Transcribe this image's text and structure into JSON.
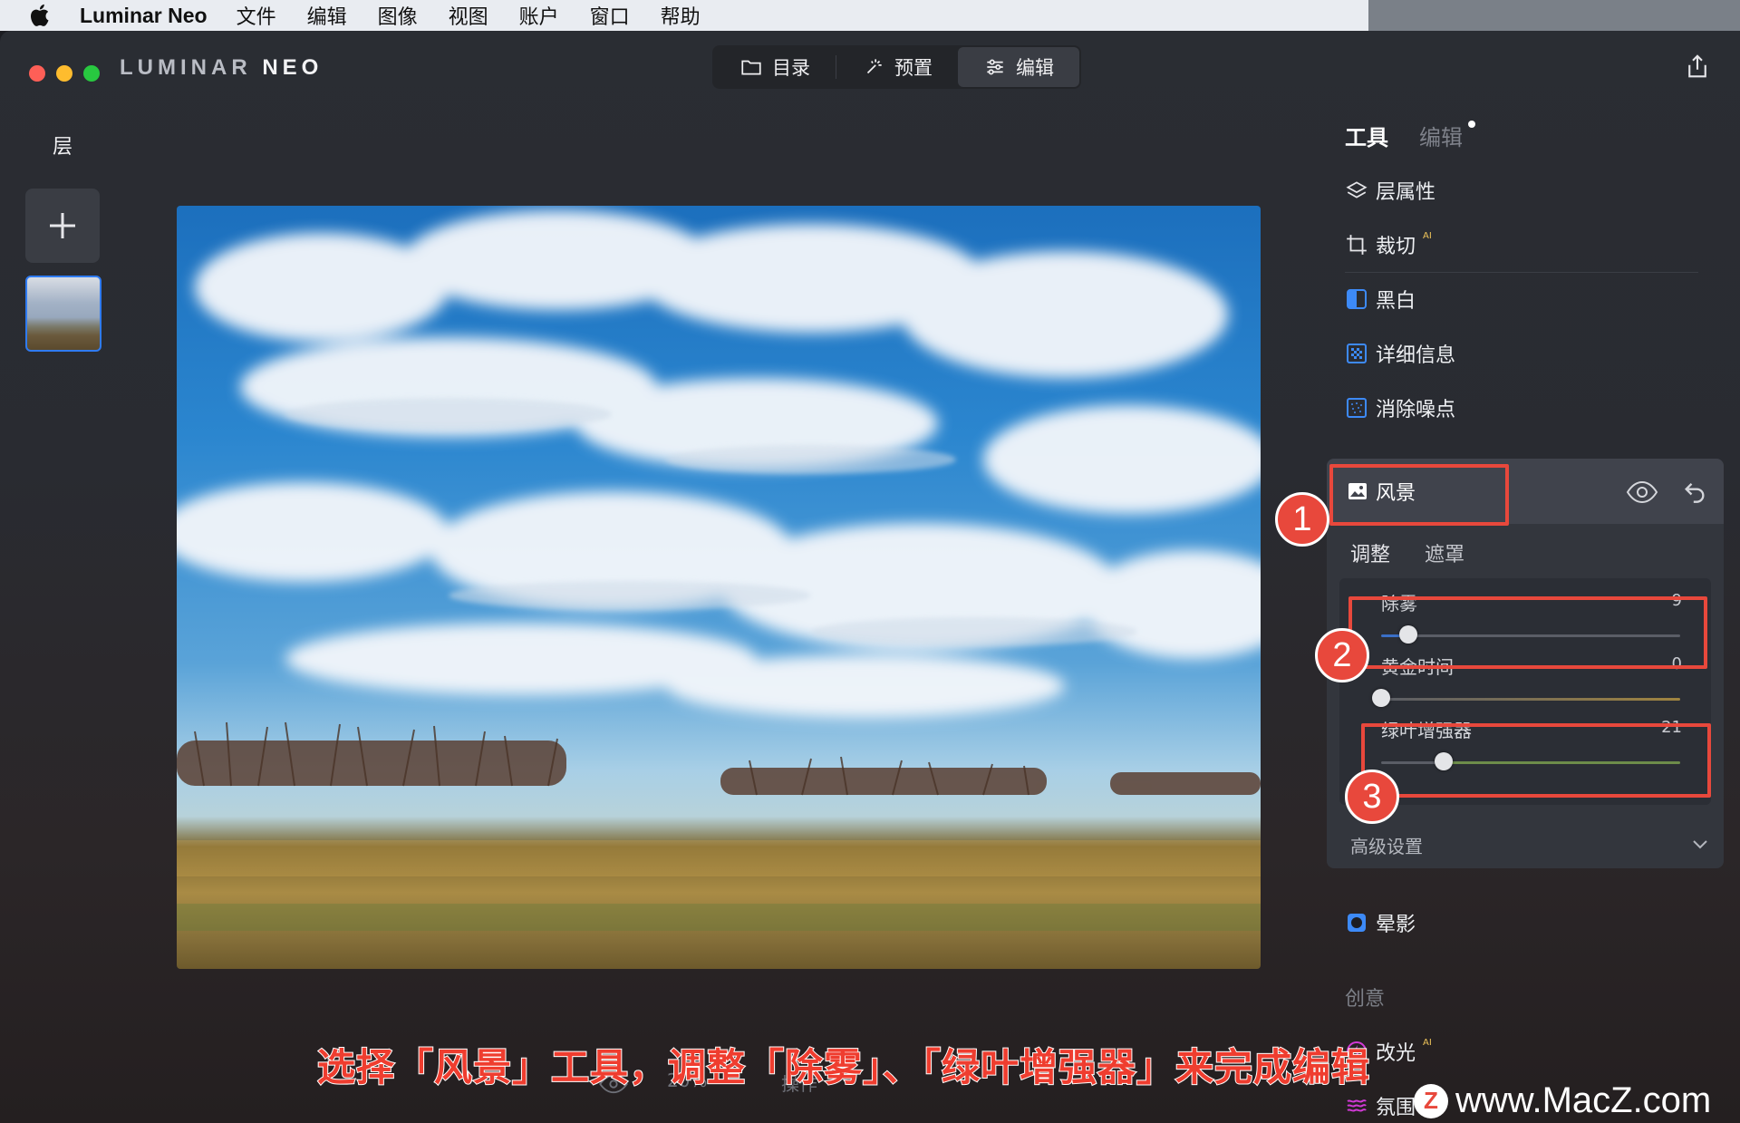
{
  "menubar": {
    "app_name": "Luminar Neo",
    "items": [
      "文件",
      "编辑",
      "图像",
      "视图",
      "账户",
      "窗口",
      "帮助"
    ]
  },
  "window": {
    "logo_left": "LUMINAR ",
    "logo_right": "NEO",
    "nav": [
      {
        "label": "目录",
        "icon": "folder-icon",
        "active": false
      },
      {
        "label": "预置",
        "icon": "magic-wand-icon",
        "active": false
      },
      {
        "label": "编辑",
        "icon": "sliders-icon",
        "active": true
      }
    ]
  },
  "layers": {
    "title": "层"
  },
  "right_panel": {
    "tabs": {
      "tools": "工具",
      "edits": "编辑"
    },
    "tools": [
      {
        "label": "层属性",
        "icon": "layers-icon"
      },
      {
        "label": "裁切",
        "icon": "crop-icon",
        "ai": "AI"
      },
      {
        "label": "黑白",
        "icon": "bw-icon"
      },
      {
        "label": "详细信息",
        "icon": "details-icon"
      },
      {
        "label": "消除噪点",
        "icon": "denoise-icon"
      }
    ],
    "landscape": {
      "title": "风景",
      "subtabs": [
        "调整",
        "遮罩"
      ],
      "sliders": [
        {
          "label": "除雾",
          "value": "9",
          "fraction": 0.09
        },
        {
          "label": "黄金时间",
          "value": "0",
          "fraction": 0.0
        },
        {
          "label": "绿叶增强器",
          "value": "21",
          "fraction": 0.21
        }
      ],
      "advanced": "高级设置"
    },
    "vignette": "晕影",
    "creative_section": "创意",
    "relight": {
      "label": "改光",
      "ai": "AI"
    },
    "atmosphere": "氛围"
  },
  "annotations": {
    "n1": "1",
    "n2": "2",
    "n3": "3",
    "caption": "选择「风景」工具，调整「除雾」、「绿叶增强器」来完成编辑"
  },
  "bottom_bar": {
    "zoom": "20%",
    "actions": "操作"
  },
  "watermark": {
    "logo": "Z",
    "text": "www.MacZ.com"
  },
  "colors": {
    "accent": "#2f7bf2",
    "annotation": "#e8483c",
    "ai": "#f0c55a"
  }
}
